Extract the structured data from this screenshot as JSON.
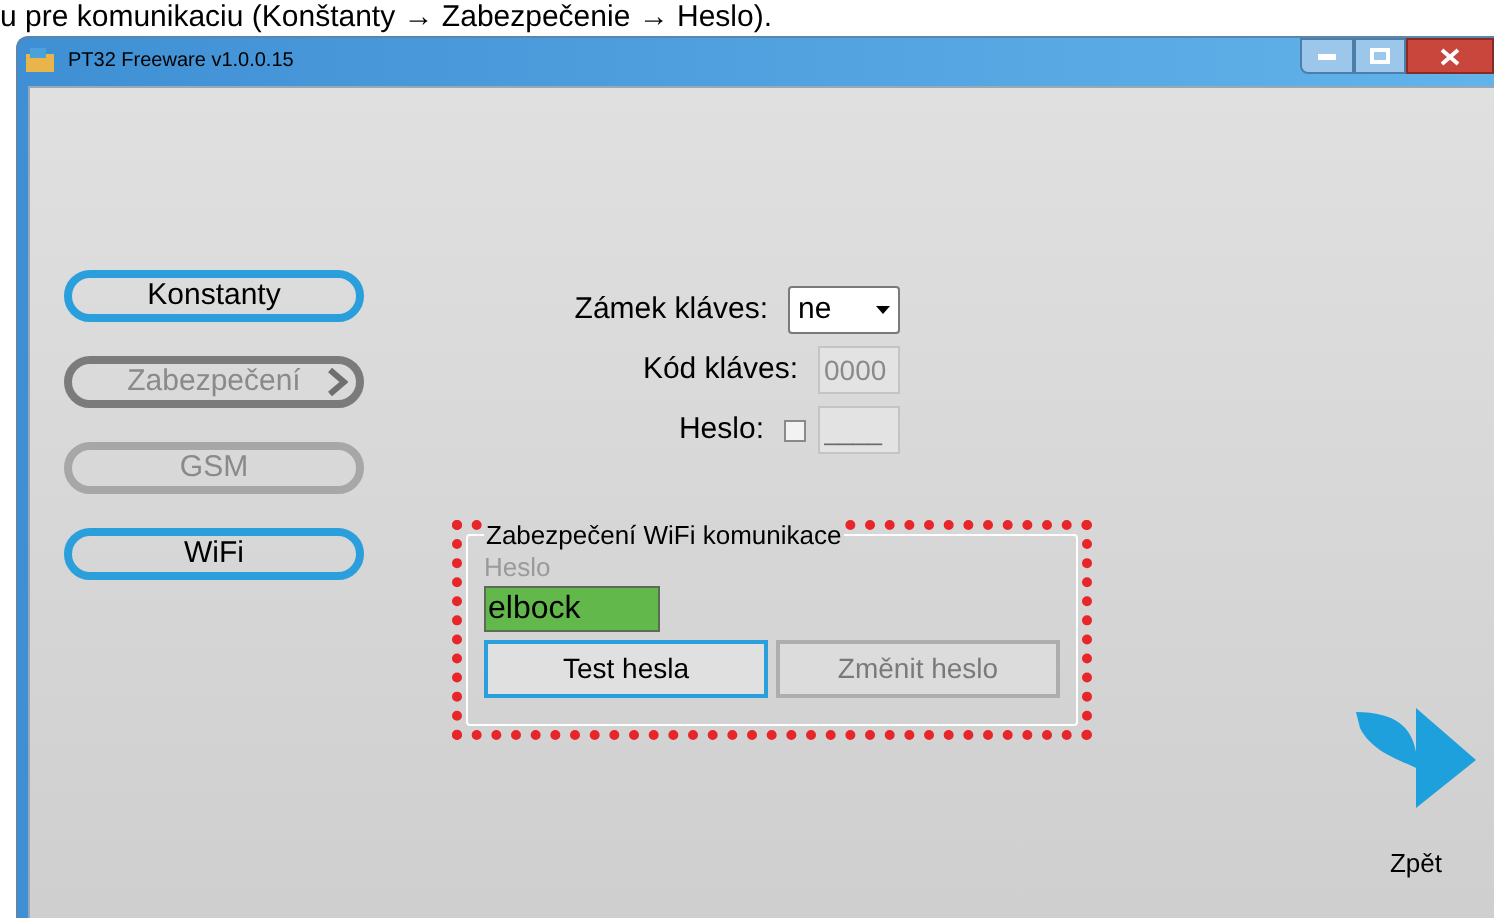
{
  "caption": "u pre komunikaciu (Konštanty → Zabezpečenie → Heslo).",
  "window": {
    "title": "PT32 Freeware v1.0.0.15"
  },
  "nav": [
    {
      "label": "Konstanty",
      "disabled": false,
      "submenu": false
    },
    {
      "label": "Zabezpečení",
      "disabled": true,
      "submenu": true
    },
    {
      "label": "GSM",
      "disabled": true,
      "submenu": false
    },
    {
      "label": "WiFi",
      "disabled": false,
      "submenu": false
    }
  ],
  "settings": [
    {
      "kind": "select",
      "label": "Zámek kláves:",
      "value": "ne"
    },
    {
      "kind": "text",
      "label": "Kód kláves:",
      "value": "0000",
      "disabled": true
    },
    {
      "kind": "checkbox",
      "label": "Heslo:",
      "checked": false,
      "placeholder": "____",
      "disabled": true
    }
  ],
  "wifi": {
    "title": "Zabezpečení WiFi komunikace",
    "password_label": "Heslo",
    "password": "elbock",
    "buttons": [
      {
        "label": "Test hesla",
        "disabled": false
      },
      {
        "label": "Změnit heslo",
        "disabled": true
      }
    ]
  },
  "back": {
    "label": "Zpět"
  }
}
